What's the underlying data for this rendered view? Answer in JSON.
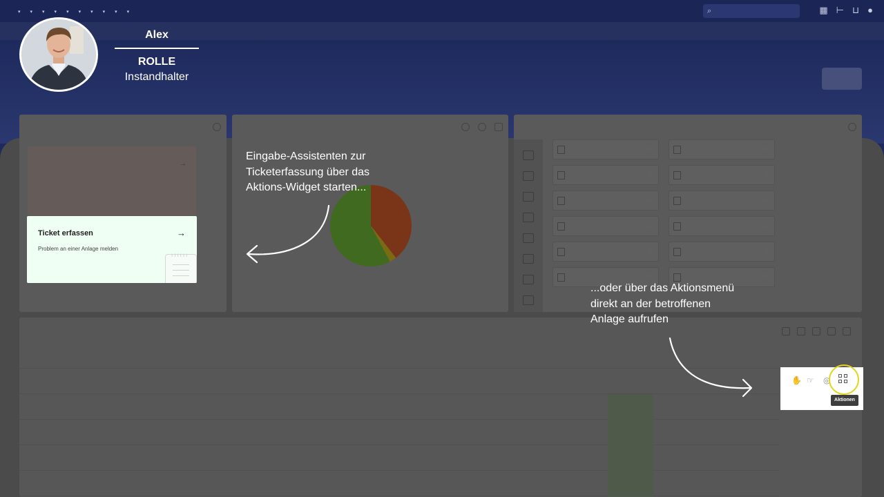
{
  "overlay": {
    "profile": {
      "name": "Alex",
      "role_label": "ROLLE",
      "role": "Instandhalter"
    },
    "callout_primary": "Eingabe-Assistenten zur\nTicketerfassung über das\nAktions-Widget starten...",
    "callout_secondary": "...oder über das Aktionsmenü\ndirekt an der betroffenen\nAnlage aufrufen"
  },
  "ticket_card": {
    "title": "Ticket erfassen",
    "subtitle": "Problem an einer Anlage melden"
  },
  "actions_popup": {
    "tooltip": "Aktionen"
  }
}
